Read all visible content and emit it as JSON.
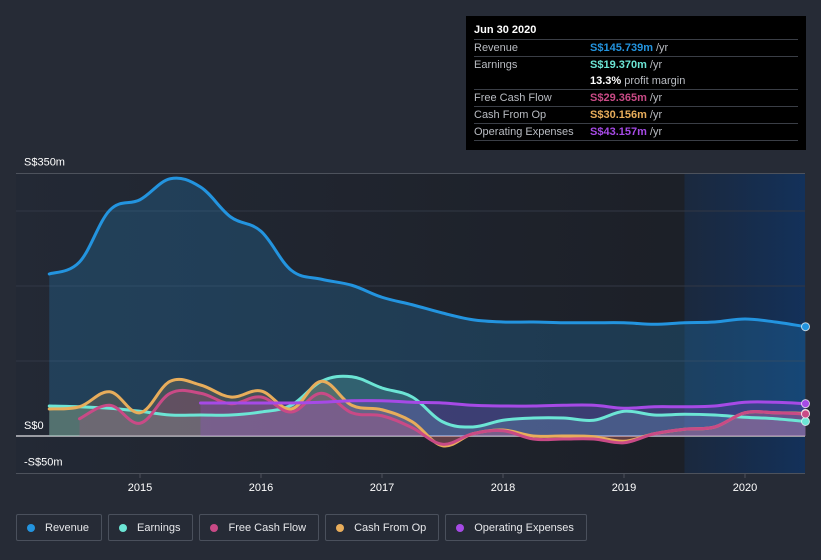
{
  "tooltip": {
    "date": "Jun 30 2020",
    "rows": [
      {
        "label": "Revenue",
        "value": "S$145.739m",
        "unit": "/yr",
        "color": "#2394df"
      },
      {
        "label": "Earnings",
        "value": "S$19.370m",
        "unit": "/yr",
        "color": "#6ce5d5"
      },
      {
        "label": "",
        "value": "13.3%",
        "unit": "profit margin",
        "color": "#ffffff"
      },
      {
        "label": "Free Cash Flow",
        "value": "S$29.365m",
        "unit": "/yr",
        "color": "#c94a86"
      },
      {
        "label": "Cash From Op",
        "value": "S$30.156m",
        "unit": "/yr",
        "color": "#e8ad5b"
      },
      {
        "label": "Operating Expenses",
        "value": "S$43.157m",
        "unit": "/yr",
        "color": "#a64ae6"
      }
    ]
  },
  "legend": [
    {
      "label": "Revenue",
      "color": "#2394df"
    },
    {
      "label": "Earnings",
      "color": "#6ce5d5"
    },
    {
      "label": "Free Cash Flow",
      "color": "#c94a86"
    },
    {
      "label": "Cash From Op",
      "color": "#e8ad5b"
    },
    {
      "label": "Operating Expenses",
      "color": "#a64ae6"
    }
  ],
  "chart_data": {
    "type": "line",
    "title": "",
    "xlabel": "",
    "ylabel": "",
    "ylim": [
      -50,
      350
    ],
    "xlim": [
      2014.25,
      2020.5
    ],
    "y_tick_labels": [
      {
        "value": 350,
        "label": "S$350m"
      },
      {
        "value": 0,
        "label": "S$0"
      },
      {
        "value": -50,
        "label": "-S$50m"
      }
    ],
    "y_gridlines": [
      350,
      300,
      200,
      100,
      0,
      -50
    ],
    "x_ticks": [
      {
        "value": 2015,
        "label": "2015"
      },
      {
        "value": 2016,
        "label": "2016"
      },
      {
        "value": 2017,
        "label": "2017"
      },
      {
        "value": 2018,
        "label": "2018"
      },
      {
        "value": 2019,
        "label": "2019"
      },
      {
        "value": 2020,
        "label": "2020"
      }
    ],
    "forecast_shade_start": 2019.5,
    "grid": true,
    "legend_position": "bottom",
    "x": [
      2014.25,
      2014.5,
      2014.75,
      2015.0,
      2015.25,
      2015.5,
      2015.75,
      2016.0,
      2016.25,
      2016.5,
      2016.75,
      2017.0,
      2017.25,
      2017.5,
      2017.75,
      2018.0,
      2018.25,
      2018.5,
      2018.75,
      2019.0,
      2019.25,
      2019.5,
      2019.75,
      2020.0,
      2020.25,
      2020.5
    ],
    "series": [
      {
        "name": "Revenue",
        "color": "#2394df",
        "values": [
          216,
          232,
          301,
          315,
          343,
          332,
          292,
          273,
          221,
          209,
          201,
          185,
          175,
          164,
          155,
          152,
          152,
          151,
          151,
          151,
          149,
          151,
          152,
          156,
          152,
          145.739
        ]
      },
      {
        "name": "Earnings",
        "color": "#6ce5d5",
        "values": [
          40,
          39,
          37,
          33,
          28,
          28,
          28,
          32,
          41,
          73,
          79,
          64,
          52,
          19,
          12,
          21,
          24,
          24,
          21,
          33,
          28,
          29,
          28,
          25,
          23,
          19.37
        ]
      },
      {
        "name": "Free Cash Flow",
        "color": "#c94a86",
        "values": [
          null,
          23,
          41,
          17,
          57,
          57,
          43,
          52,
          32,
          57,
          31,
          27,
          11,
          -11,
          3,
          7,
          -4,
          -4,
          -4,
          -9,
          3,
          9,
          12,
          31,
          31,
          29.365
        ]
      },
      {
        "name": "Cash From Op",
        "color": "#e8ad5b",
        "values": [
          36,
          39,
          59,
          31,
          73,
          68,
          52,
          60,
          36,
          73,
          41,
          35,
          19,
          -13,
          3,
          8,
          0,
          0,
          -1,
          -7,
          3,
          9,
          12,
          31,
          31,
          30.156
        ]
      },
      {
        "name": "Operating Expenses",
        "color": "#a64ae6",
        "values": [
          null,
          null,
          null,
          null,
          null,
          44,
          44,
          44,
          44,
          45,
          47,
          47,
          45,
          44,
          41,
          40,
          40,
          41,
          41,
          37,
          39,
          39,
          40,
          45,
          45,
          43.157
        ]
      }
    ]
  }
}
